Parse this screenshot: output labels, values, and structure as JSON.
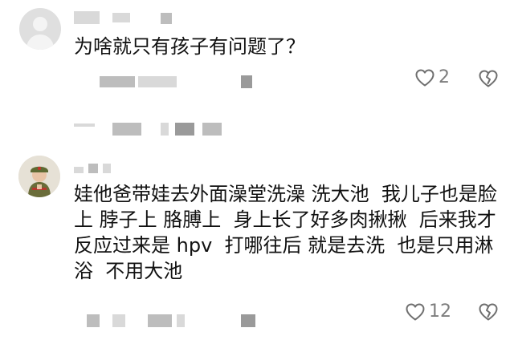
{
  "comments": [
    {
      "text": "为啥就只有孩子有问题了？",
      "like_count": "2",
      "avatar_icon": "default-user-avatar-icon"
    },
    {
      "text": "娃他爸带娃去外面澡堂洗澡 洗大池  我儿子也是脸上 脖子上 胳膊上  身上长了好多肉揪揪  后来我才反应过来是 hpv  打哪往后 就是去洗  也是只用淋浴  不用大池",
      "like_count": "12",
      "avatar_icon": "user-photo-avatar-icon"
    }
  ],
  "icons": {
    "like": "heart-icon",
    "dislike": "broken-heart-icon"
  },
  "colors": {
    "text": "#111111",
    "meta": "#7d7d7d",
    "redaction": "#bdbdbd"
  }
}
